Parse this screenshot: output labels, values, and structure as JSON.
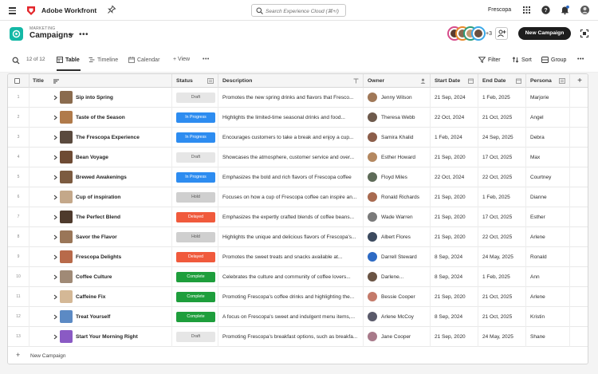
{
  "topbar": {
    "app_name": "Adobe Workfront",
    "search_placeholder": "Search Experience Cloud (⌘+/)",
    "org": "Frescopa"
  },
  "header": {
    "breadcrumb": "MARKETING",
    "title": "Campaigns",
    "more": "•••",
    "collaborator_overflow": "+3",
    "new_button": "New Campaign",
    "avatar_colors": [
      "#d64c8a",
      "#e88a2c",
      "#2d9d78",
      "#3aa8e8"
    ]
  },
  "views": {
    "count": "12 of 12",
    "table": "Table",
    "timeline": "Timeline",
    "calendar": "Calendar",
    "add_view": "+ View",
    "more": "•••",
    "filter": "Filter",
    "sort": "Sort",
    "group": "Group"
  },
  "columns": {
    "title": "Title",
    "status": "Status",
    "description": "Description",
    "owner": "Owner",
    "start": "Start Date",
    "end": "End Date",
    "persona": "Persona"
  },
  "rows": [
    {
      "num": "1",
      "title": "Sip into Spring",
      "status": "Draft",
      "description": "Promotes the new spring drinks and flavors that Fresco...",
      "owner": "Jenny Wilson",
      "start": "21 Sep, 2024",
      "end": "1 Feb, 2025",
      "persona": "Marjorie",
      "thumb": "#8a6b4e",
      "avatar": "#a07858"
    },
    {
      "num": "2",
      "title": "Taste of the Season",
      "status": "In Progress",
      "description": "Highlights the limited-time seasonal drinks and food...",
      "owner": "Theresa Webb",
      "start": "22 Oct, 2024",
      "end": "21 Oct, 2025",
      "persona": "Angel",
      "thumb": "#b07a4a",
      "avatar": "#6e5a4c"
    },
    {
      "num": "3",
      "title": "The Frescopa Experience",
      "status": "In Progress",
      "description": "Encourages customers to take a break and enjoy a cup...",
      "owner": "Samira Khalid",
      "start": "1 Feb, 2024",
      "end": "24 Sep, 2025",
      "persona": "Debra",
      "thumb": "#5a4a3e",
      "avatar": "#8c5e4a"
    },
    {
      "num": "4",
      "title": "Bean Voyage",
      "status": "Draft",
      "description": "Showcases the atmosphere, customer service and over...",
      "owner": "Esther Howard",
      "start": "21 Sep, 2020",
      "end": "17 Oct, 2025",
      "persona": "Max",
      "thumb": "#6e4b34",
      "avatar": "#b48860"
    },
    {
      "num": "5",
      "title": "Brewed Awakenings",
      "status": "In Progress",
      "description": "Emphasizes the bold and rich flavors of Frescopa coffee",
      "owner": "Floyd Miles",
      "start": "22 Oct, 2024",
      "end": "22 Oct, 2025",
      "persona": "Courtney",
      "thumb": "#7c5b40",
      "avatar": "#5e6b58"
    },
    {
      "num": "6",
      "title": "Cup of inspiration",
      "status": "Hold",
      "description": "Focuses on how a cup of Frescopa coffee can inspire an...",
      "owner": "Ronald Richards",
      "start": "21 Sep, 2020",
      "end": "1 Feb, 2025",
      "persona": "Dianne",
      "thumb": "#c4a88a",
      "avatar": "#a86a50"
    },
    {
      "num": "7",
      "title": "The Perfect Blend",
      "status": "Delayed",
      "description": "Emphasizes the expertly crafted blends of coffee beans...",
      "owner": "Wade Warren",
      "start": "21 Sep, 2020",
      "end": "17 Oct, 2025",
      "persona": "Esther",
      "thumb": "#4e3a2c",
      "avatar": "#7a7a7a"
    },
    {
      "num": "8",
      "title": "Savor the Flavor",
      "status": "Hold",
      "description": "Highlights the unique and delicious flavors of Frescopa's...",
      "owner": "Albert Flores",
      "start": "21 Sep, 2020",
      "end": "22 Oct, 2025",
      "persona": "Arlene",
      "thumb": "#9a7658",
      "avatar": "#3c4a5e"
    },
    {
      "num": "9",
      "title": "Frescopa Delights",
      "status": "Delayed",
      "description": "Promotes the sweet treats and snacks available at...",
      "owner": "Darrell Steward",
      "start": "8 Sep, 2024",
      "end": "24 May, 2025",
      "persona": "Ronald",
      "thumb": "#b86a4a",
      "avatar": "#2d6ac4"
    },
    {
      "num": "10",
      "title": "Coffee Culture",
      "status": "Complete",
      "description": "Celebrates the culture and community of coffee lovers...",
      "owner": "Darlene...",
      "start": "8 Sep, 2024",
      "end": "1 Feb, 2025",
      "persona": "Ann",
      "thumb": "#a08a76",
      "avatar": "#6a5444"
    },
    {
      "num": "11",
      "title": "Caffeine Fix",
      "status": "Complete",
      "description": "Promoting Frescopa's coffee drinks and highlighting the...",
      "owner": "Bessie Cooper",
      "start": "21 Sep, 2020",
      "end": "21 Oct, 2025",
      "persona": "Arlene",
      "thumb": "#d4b896",
      "avatar": "#c47a6a"
    },
    {
      "num": "12",
      "title": "Treat Yourself",
      "status": "Complete",
      "description": "A focus on Frescopa's sweet and indulgent menu items,...",
      "owner": "Arlene McCoy",
      "start": "8 Sep, 2024",
      "end": "21 Oct, 2025",
      "persona": "Kristin",
      "thumb": "#5c8ac4",
      "avatar": "#5a5a6a"
    },
    {
      "num": "13",
      "title": "Start Your Morning Right",
      "status": "Draft",
      "description": "Promoting Frescopa's breakfast options, such as breakfa...",
      "owner": "Jane Cooper",
      "start": "21 Sep, 2020",
      "end": "24 May, 2025",
      "persona": "Shane",
      "thumb": "#8a5ac4",
      "avatar": "#a87a8a"
    }
  ],
  "status_styles": {
    "Draft": {
      "bg": "#e6e6e6",
      "fg": "#555555"
    },
    "In Progress": {
      "bg": "#2d8cf0",
      "fg": "#ffffff"
    },
    "Hold": {
      "bg": "#cfcfcf",
      "fg": "#555555"
    },
    "Delayed": {
      "bg": "#f05a3c",
      "fg": "#ffffff"
    },
    "Complete": {
      "bg": "#1e9e3c",
      "fg": "#ffffff"
    }
  },
  "footer": {
    "plus": "+",
    "add_label": "New Campaign"
  }
}
